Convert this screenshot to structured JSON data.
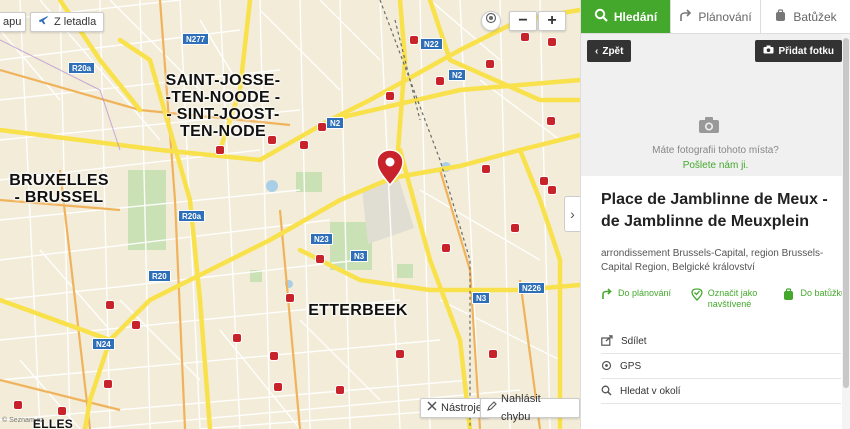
{
  "map": {
    "top_left_partial": "apu",
    "airport_button": "Z letadla",
    "zoom_out": "−",
    "zoom_in": "+",
    "districts": {
      "saint_josse": "SAINT-JOSSE-\n-TEN-NOODE -\n- SINT-JOOST-\nTEN-NODE",
      "bruxelles": "BRUXELLES\n- BRUSSEL",
      "etterbeek": "ETTERBEEK",
      "bottom_partial": "ELLES"
    },
    "road_shields": {
      "n277": "N277",
      "n22": "N22",
      "r20a_top": "R20a",
      "n2_right": "N2",
      "n2_center": "N2",
      "r20a_mid": "R20a",
      "n23": "N23",
      "n3_center": "N3",
      "r20": "R20",
      "n3_right": "N3",
      "n226": "N226",
      "n24": "N24"
    },
    "tools_label": "Nástroje",
    "report_label": "Nahlásit chybu",
    "copyright": "© Seznam.cz",
    "marker_color": "#c8222b",
    "road_color": "#f8e14a"
  },
  "panel": {
    "tabs": [
      {
        "label": "Hledání",
        "icon": "search-icon"
      },
      {
        "label": "Plánování",
        "icon": "route-icon"
      },
      {
        "label": "Batůžek",
        "icon": "backpack-icon"
      }
    ],
    "back_label": "Zpět",
    "add_photo_label": "Přidat fotku",
    "photo_question": "Máte fotografii tohoto místa?",
    "photo_send": "Pošlete nám ji.",
    "place_title": "Place de Jamblinne de Meux - de Jamblinne de Meuxplein",
    "place_address": "arrondissement Brussels-Capital, region Brussels-Capital Region, Belgické království",
    "actions": {
      "plan": "Do plánování",
      "visited": "Označit jako navštívené",
      "backpack": "Do batůžku"
    },
    "menu": {
      "share": "Sdílet",
      "gps": "GPS",
      "nearby": "Hledat v okolí"
    },
    "accent_color": "#44a82d"
  }
}
